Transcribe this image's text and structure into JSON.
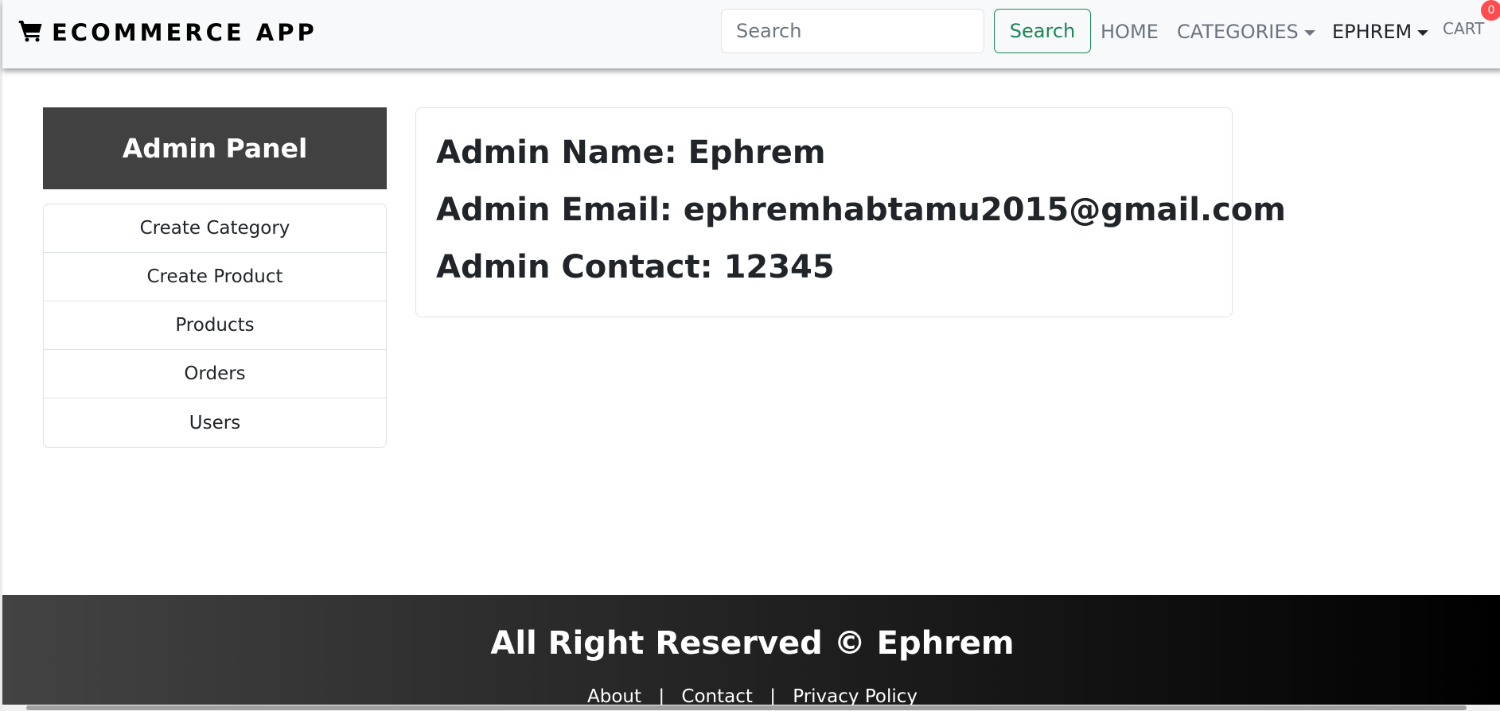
{
  "navbar": {
    "brand_text": "ECOMMERCE APP",
    "brand_icon": "shopping-cart-icon",
    "search_placeholder": "Search",
    "search_button": "Search",
    "home": "HOME",
    "categories": "CATEGORIES",
    "user": "EPHREM",
    "cart": "CART",
    "cart_count": "0"
  },
  "sidebar": {
    "title": "Admin Panel",
    "items": [
      {
        "label": "Create Category"
      },
      {
        "label": "Create Product"
      },
      {
        "label": "Products"
      },
      {
        "label": "Orders"
      },
      {
        "label": "Users"
      }
    ]
  },
  "admin": {
    "name": "Admin Name: Ephrem",
    "email": "Admin Email: ephremhabtamu2015@gmail.com",
    "contact": "Admin Contact: 12345"
  },
  "footer": {
    "title": "All Right Reserved © Ephrem",
    "links": [
      "About",
      "Contact",
      "Privacy Policy"
    ],
    "separator": "|"
  },
  "colors": {
    "success": "#198754",
    "panel_header": "#414141",
    "badge": "#ff4d4f"
  }
}
